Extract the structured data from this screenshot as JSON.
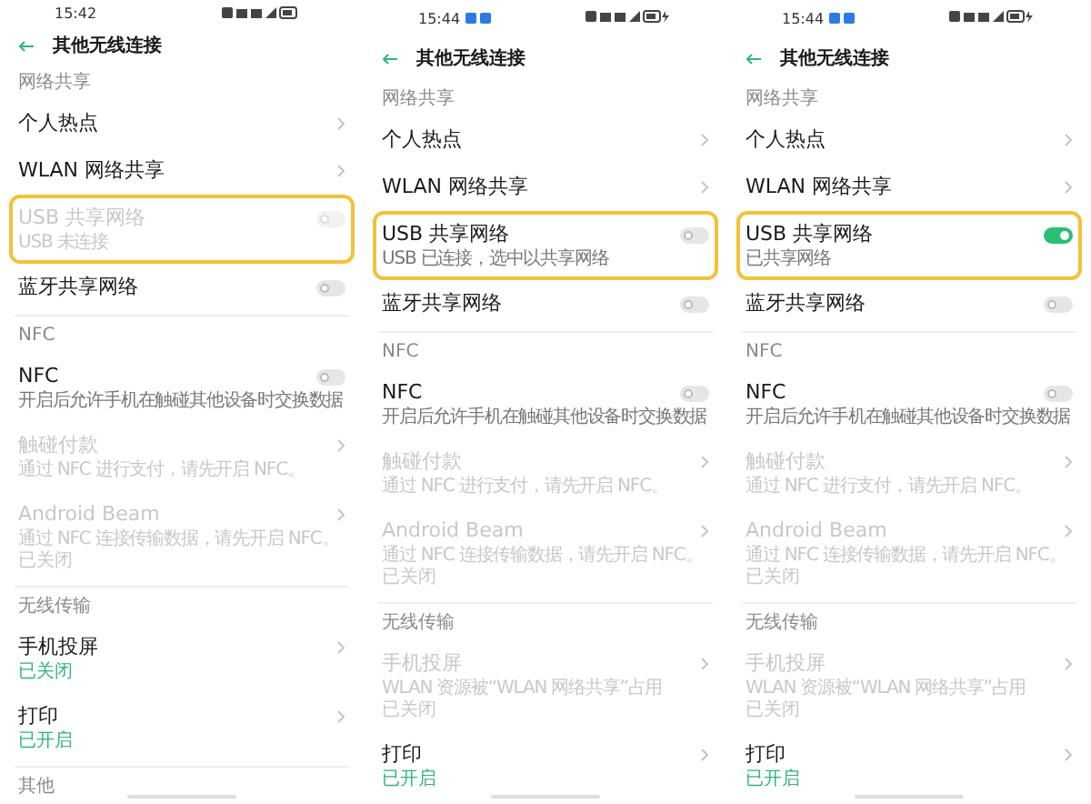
{
  "screens": [
    {
      "status_bar": {
        "time": "15:42",
        "notifications": false,
        "charging": false
      },
      "title": "其他无线连接",
      "sections": [
        {
          "header": "网络共享",
          "items": [
            {
              "kind": "link",
              "title": "个人热点",
              "disabled": false,
              "highlighted": false
            },
            {
              "kind": "link",
              "title": "WLAN 网络共享",
              "disabled": false,
              "highlighted": false
            },
            {
              "kind": "toggle",
              "title": "USB 共享网络",
              "subtitle": [
                "USB 未连接"
              ],
              "disabled": true,
              "highlighted": true,
              "on": false
            },
            {
              "kind": "toggle",
              "title": "蓝牙共享网络",
              "disabled": false,
              "highlighted": false,
              "on": false
            }
          ]
        },
        {
          "header": "NFC",
          "items": [
            {
              "kind": "toggle",
              "title": "NFC",
              "subtitle": [
                "开启后允许手机在触碰其他设备时交换数据"
              ],
              "disabled": false,
              "highlighted": false,
              "on": false
            },
            {
              "kind": "link",
              "title": "触碰付款",
              "subtitle": [
                "通过 NFC 进行支付，请先开启 NFC。"
              ],
              "disabled": true,
              "highlighted": false
            },
            {
              "kind": "link",
              "title": "Android Beam",
              "subtitle": [
                "通过 NFC 连接传输数据，请先开启 NFC。"
              ],
              "status": "已关闭",
              "disabled": true,
              "highlighted": false
            }
          ]
        },
        {
          "header": "无线传输",
          "items": [
            {
              "kind": "link",
              "title": "手机投屏",
              "status": "已关闭",
              "disabled": false,
              "highlighted": false
            },
            {
              "kind": "link",
              "title": "打印",
              "status": "已开启",
              "disabled": false,
              "highlighted": false
            }
          ]
        },
        {
          "header": "其他"
        }
      ]
    },
    {
      "status_bar": {
        "time": "15:44",
        "notifications": true,
        "charging": true
      },
      "title": "其他无线连接",
      "sections": [
        {
          "header": "网络共享",
          "items": [
            {
              "kind": "link",
              "title": "个人热点",
              "disabled": false,
              "highlighted": false
            },
            {
              "kind": "link",
              "title": "WLAN 网络共享",
              "disabled": false,
              "highlighted": false
            },
            {
              "kind": "toggle",
              "title": "USB 共享网络",
              "subtitle": [
                "USB 已连接，选中以共享网络"
              ],
              "disabled": false,
              "highlighted": true,
              "on": false
            },
            {
              "kind": "toggle",
              "title": "蓝牙共享网络",
              "disabled": false,
              "highlighted": false,
              "on": false
            }
          ]
        },
        {
          "header": "NFC",
          "items": [
            {
              "kind": "toggle",
              "title": "NFC",
              "subtitle": [
                "开启后允许手机在触碰其他设备时交换数据"
              ],
              "disabled": false,
              "highlighted": false,
              "on": false
            },
            {
              "kind": "link",
              "title": "触碰付款",
              "subtitle": [
                "通过 NFC 进行支付，请先开启 NFC。"
              ],
              "disabled": true,
              "highlighted": false
            },
            {
              "kind": "link",
              "title": "Android Beam",
              "subtitle": [
                "通过 NFC 连接传输数据，请先开启 NFC。"
              ],
              "status": "已关闭",
              "disabled": true,
              "highlighted": false
            }
          ]
        },
        {
          "header": "无线传输",
          "items": [
            {
              "kind": "link",
              "title": "手机投屏",
              "subtitle": [
                "WLAN 资源被“WLAN 网络共享”占用"
              ],
              "status": "已关闭",
              "disabled": true,
              "highlighted": false
            },
            {
              "kind": "link",
              "title": "打印",
              "status": "已开启",
              "disabled": false,
              "highlighted": false
            }
          ]
        }
      ]
    },
    {
      "status_bar": {
        "time": "15:44",
        "notifications": true,
        "charging": true
      },
      "title": "其他无线连接",
      "sections": [
        {
          "header": "网络共享",
          "items": [
            {
              "kind": "link",
              "title": "个人热点",
              "disabled": false,
              "highlighted": false
            },
            {
              "kind": "link",
              "title": "WLAN 网络共享",
              "disabled": false,
              "highlighted": false
            },
            {
              "kind": "toggle",
              "title": "USB 共享网络",
              "subtitle": [
                "已共享网络"
              ],
              "disabled": false,
              "highlighted": true,
              "on": true
            },
            {
              "kind": "toggle",
              "title": "蓝牙共享网络",
              "disabled": false,
              "highlighted": false,
              "on": false
            }
          ]
        },
        {
          "header": "NFC",
          "items": [
            {
              "kind": "toggle",
              "title": "NFC",
              "subtitle": [
                "开启后允许手机在触碰其他设备时交换数据"
              ],
              "disabled": false,
              "highlighted": false,
              "on": false
            },
            {
              "kind": "link",
              "title": "触碰付款",
              "subtitle": [
                "通过 NFC 进行支付，请先开启 NFC。"
              ],
              "disabled": true,
              "highlighted": false
            },
            {
              "kind": "link",
              "title": "Android Beam",
              "subtitle": [
                "通过 NFC 连接传输数据，请先开启 NFC。"
              ],
              "status": "已关闭",
              "disabled": true,
              "highlighted": false
            }
          ]
        },
        {
          "header": "无线传输",
          "items": [
            {
              "kind": "link",
              "title": "手机投屏",
              "subtitle": [
                "WLAN 资源被“WLAN 网络共享”占用"
              ],
              "status": "已关闭",
              "disabled": true,
              "highlighted": false
            },
            {
              "kind": "link",
              "title": "打印",
              "status": "已开启",
              "disabled": false,
              "highlighted": false
            }
          ]
        }
      ]
    }
  ]
}
